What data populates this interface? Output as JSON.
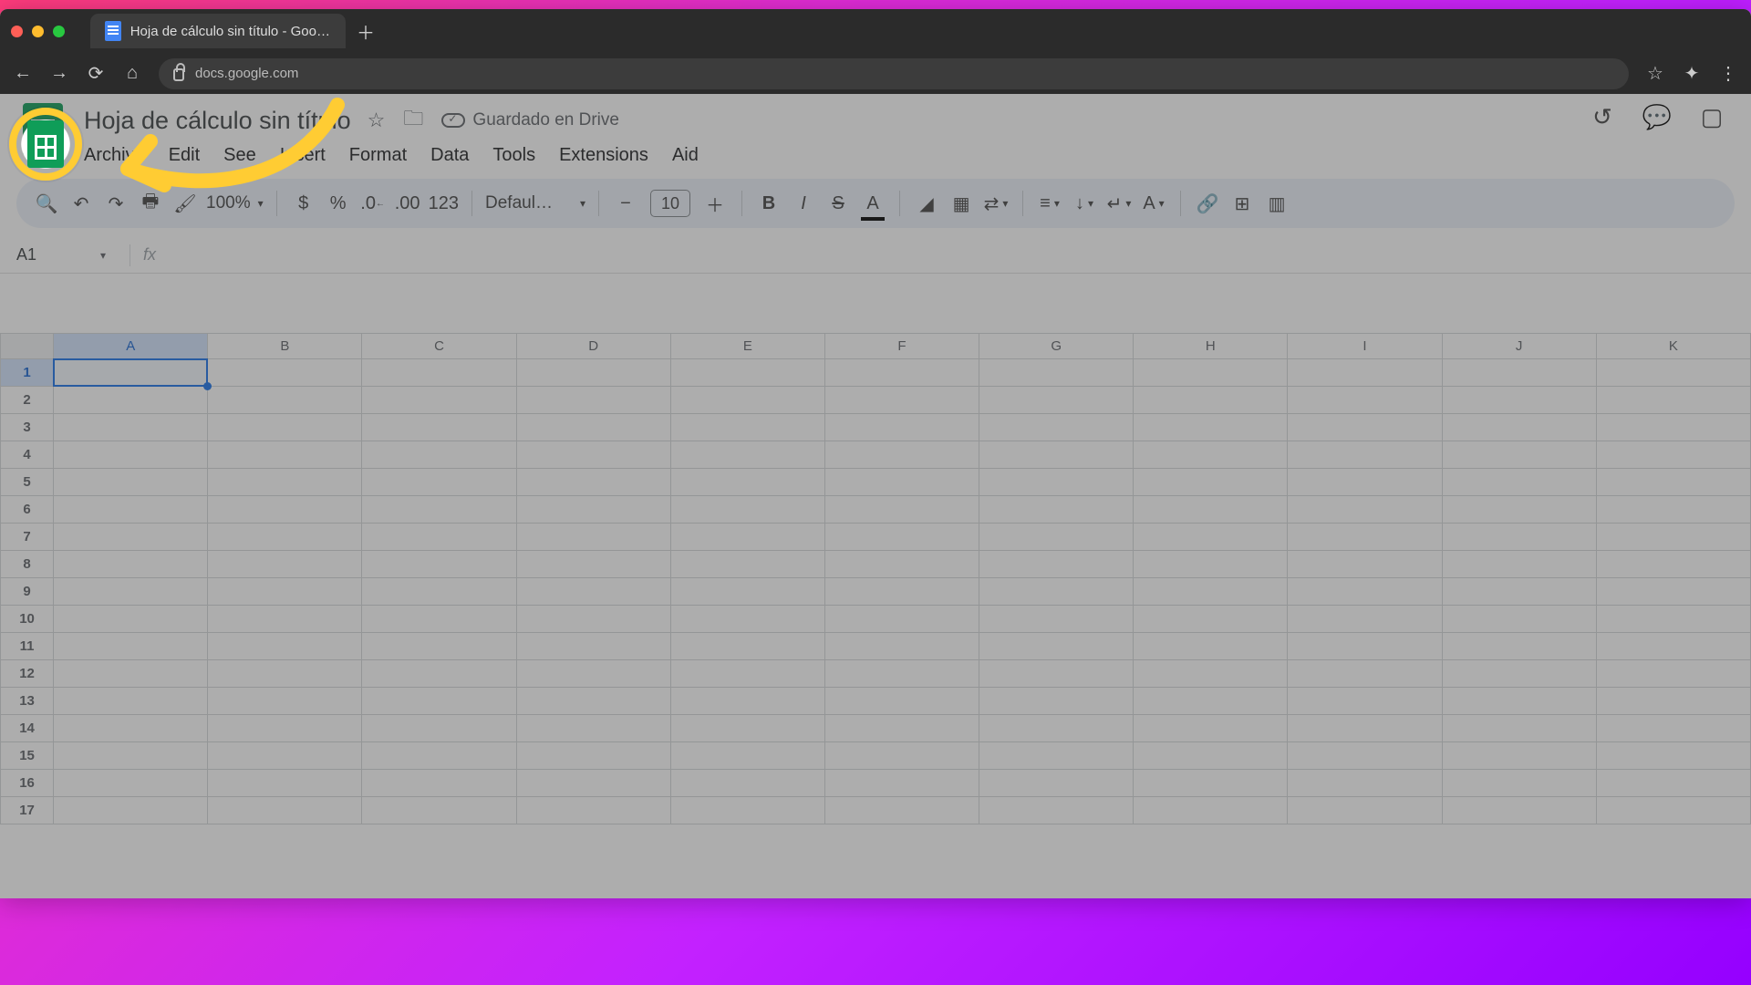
{
  "browser": {
    "tab_title": "Hoja de cálculo sin título - Google",
    "url": "docs.google.com"
  },
  "doc": {
    "title": "Hoja de cálculo sin título",
    "drive_status": "Guardado en Drive"
  },
  "menu": {
    "archive": "Archive",
    "edit": "Edit",
    "see": "See",
    "insert": "Insert",
    "format": "Format",
    "data": "Data",
    "tools": "Tools",
    "extensions": "Extensions",
    "aid": "Aid"
  },
  "toolbar": {
    "zoom": "100%",
    "currency": "$",
    "percent": "%",
    "dec_less": ".0←",
    "dec_more": ".00",
    "numfmt": "123",
    "font": "Defaul…",
    "font_size": "10"
  },
  "name_box": "A1",
  "fx_label": "fx",
  "columns": [
    "A",
    "B",
    "C",
    "D",
    "E",
    "F",
    "G",
    "H",
    "I",
    "J",
    "K"
  ],
  "rows": [
    "1",
    "2",
    "3",
    "4",
    "5",
    "6",
    "7",
    "8",
    "9",
    "10",
    "11",
    "12",
    "13",
    "14",
    "15",
    "16",
    "17"
  ],
  "selected": {
    "col": "A",
    "row": "1"
  }
}
